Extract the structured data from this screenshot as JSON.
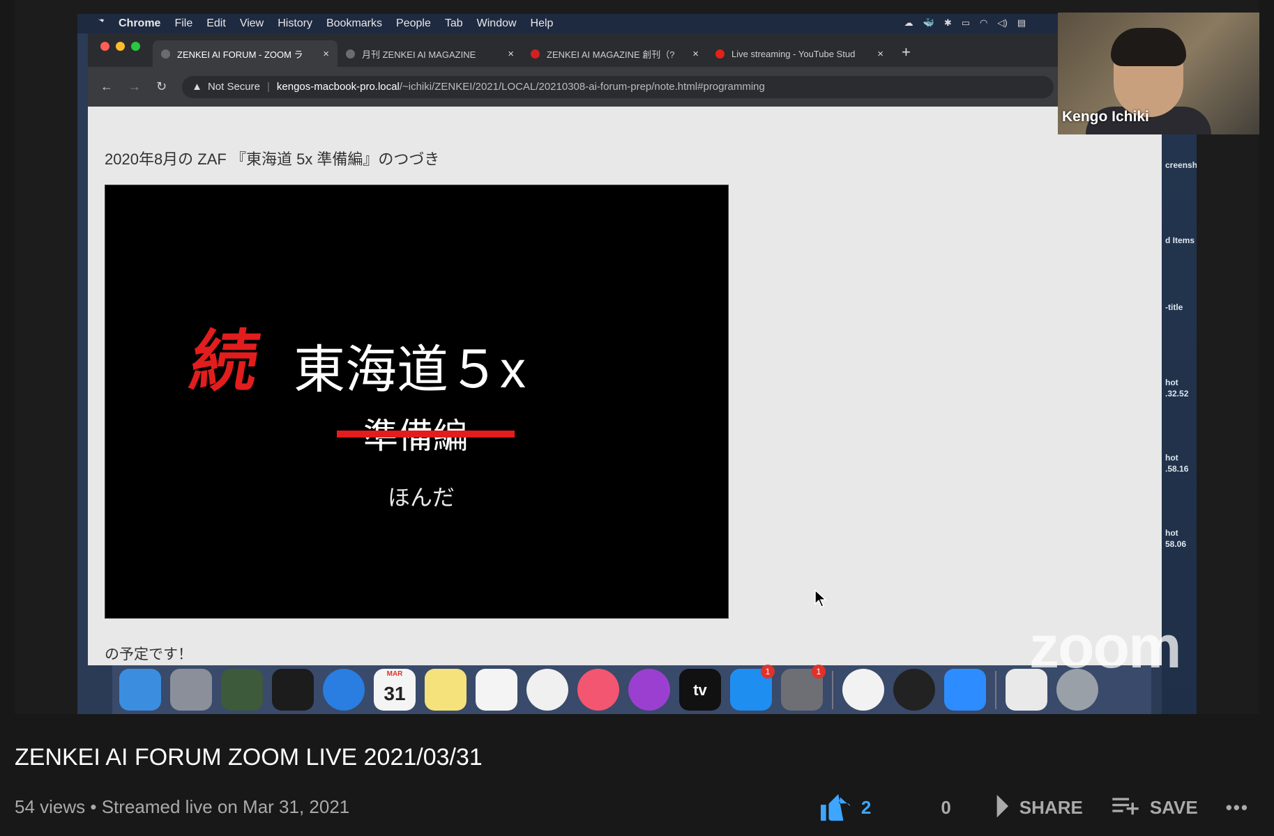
{
  "screen": {
    "menubar": {
      "app": "Chrome",
      "items": [
        "File",
        "Edit",
        "View",
        "History",
        "Bookmarks",
        "People",
        "Tab",
        "Window",
        "Help"
      ]
    },
    "tabs": [
      {
        "label": "ZENKEI AI FORUM - ZOOM ラ",
        "active": true,
        "icon_color": "#6a6c70"
      },
      {
        "label": "月刊 ZENKEI AI MAGAZINE",
        "active": false,
        "icon_color": "#6a6c70"
      },
      {
        "label": "ZENKEI AI MAGAZINE 創刊（?",
        "active": false,
        "icon_color": "#d42020"
      },
      {
        "label": "Live streaming - YouTube Stud",
        "active": false,
        "icon_color": "#e62117"
      }
    ],
    "address": {
      "security": "Not Secure",
      "host": "kengos-macbook-pro.local",
      "path": "/~ichiki/ZENKEI/2021/LOCAL/20210308-ai-forum-prep/note.html#programming"
    },
    "page": {
      "heading": "2020年8月の ZAF 『東海道 5x 準備編』のつづき",
      "slide": {
        "prefix": "続",
        "title": "東海道５x",
        "struck_subtitle": "準備編",
        "author": "ほんだ"
      },
      "footnote": "の予定です！"
    },
    "desktop_labels": [
      "creensh",
      "d Items",
      "-title",
      "hot",
      ".32.52",
      "hot",
      ".58.16",
      "hot",
      "58.06"
    ],
    "dock": {
      "apps": [
        {
          "name": "finder",
          "color": "#3b8de0"
        },
        {
          "name": "launchpad",
          "color": "#8a8f99"
        },
        {
          "name": "mission-control",
          "color": "#3d5a3a"
        },
        {
          "name": "terminal",
          "color": "#1c1c1c"
        },
        {
          "name": "safari",
          "color": "#2a7de1"
        },
        {
          "name": "calendar",
          "color": "#f4f4f4",
          "label": "31",
          "sublabel": "MAR"
        },
        {
          "name": "notes",
          "color": "#f6e27a"
        },
        {
          "name": "reminders",
          "color": "#f4f4f4"
        },
        {
          "name": "photos",
          "color": "#f0f0f0"
        },
        {
          "name": "music",
          "color": "#f35670"
        },
        {
          "name": "podcasts",
          "color": "#9b3fd0"
        },
        {
          "name": "apple-tv",
          "color": "#111111",
          "label": "tv"
        },
        {
          "name": "app-store",
          "color": "#1f8ef1",
          "badge": "1"
        },
        {
          "name": "system-preferences",
          "color": "#6d6f75",
          "badge": "1"
        },
        {
          "name": "chrome",
          "color": "#f2f2f2"
        },
        {
          "name": "x11",
          "color": "#222222"
        },
        {
          "name": "zoom",
          "color": "#2d8cff"
        },
        {
          "name": "document",
          "color": "#e9e9e9"
        },
        {
          "name": "trash",
          "color": "#9aa0a8"
        }
      ]
    },
    "participant": {
      "name": "Kengo Ichiki"
    },
    "watermark": "zoom"
  },
  "video": {
    "title": "ZENKEI AI FORUM ZOOM LIVE 2021/03/31",
    "views": "54 views",
    "separator": " • ",
    "streamed": "Streamed live on Mar 31, 2021",
    "likes": "2",
    "dislikes": "0",
    "share_label": "SHARE",
    "save_label": "SAVE",
    "more_label": "•••"
  },
  "colors": {
    "accent_like": "#3ea6ff",
    "slide_red": "#e31d1d"
  }
}
